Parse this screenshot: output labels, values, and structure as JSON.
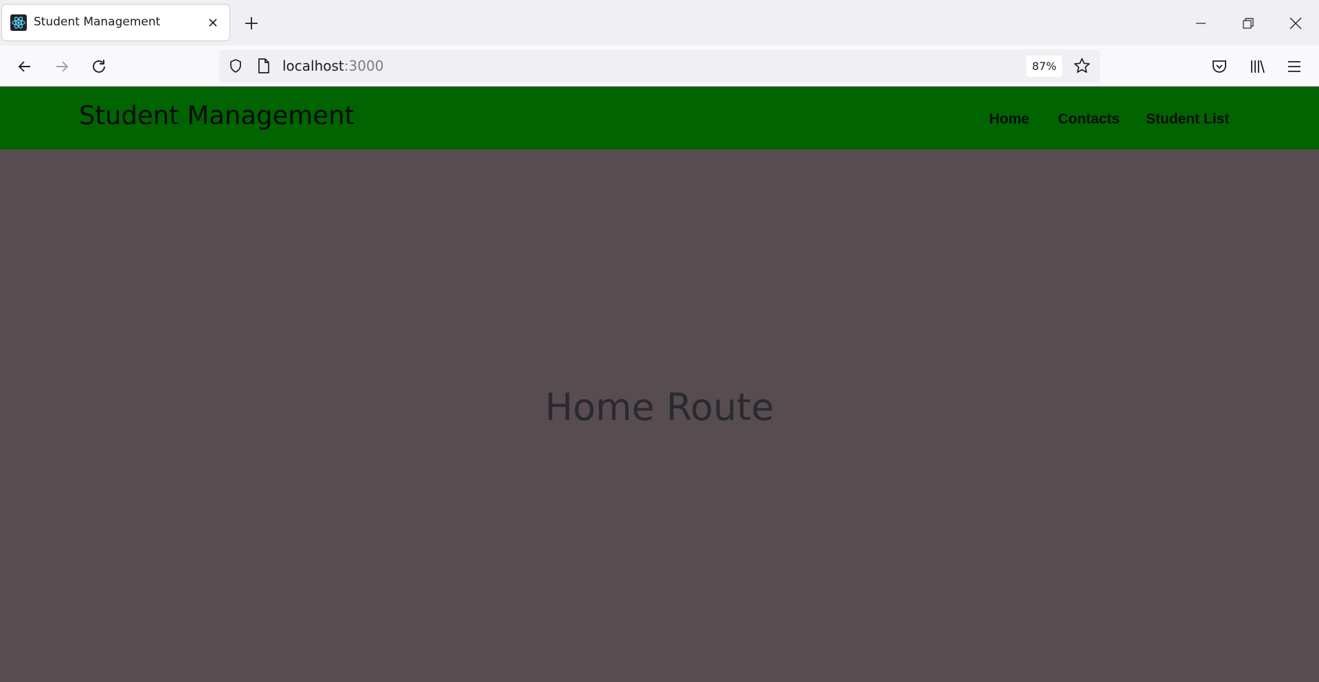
{
  "browser": {
    "tab": {
      "title": "Student Management",
      "favicon": "react-atom-icon"
    },
    "url": {
      "host": "localhost",
      "port": ":3000"
    },
    "zoom": "87%"
  },
  "site": {
    "brand": "Student Management",
    "nav": [
      {
        "label": "Home"
      },
      {
        "label": "Contacts"
      },
      {
        "label": "Student List"
      }
    ],
    "main": {
      "title": "Home Route"
    }
  },
  "colors": {
    "header_bg": "#006400",
    "page_bg": "#574d51",
    "title_text": "#2a2a30"
  }
}
